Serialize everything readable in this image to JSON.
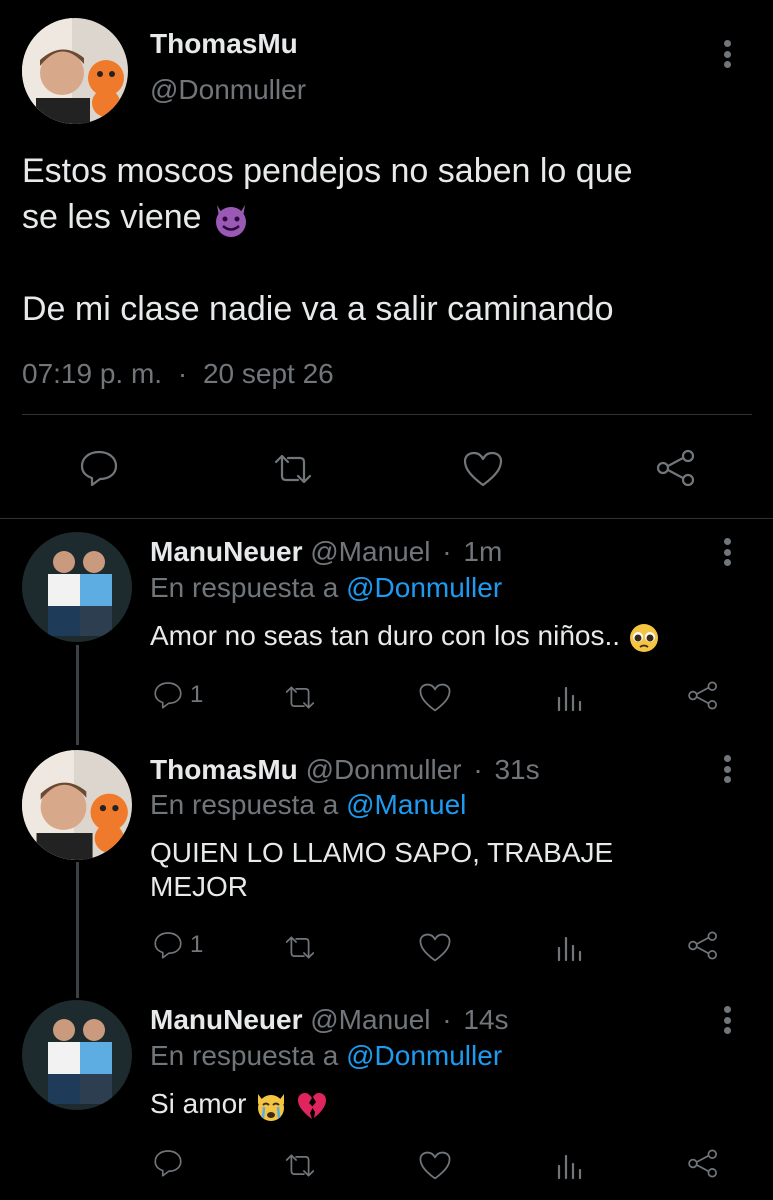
{
  "main_tweet": {
    "author_name": "ThomasMu",
    "author_handle": "@Donmuller",
    "text_line1": "Estos moscos pendejos no saben lo que",
    "text_line2": "se les viene",
    "emoji": "smiling-devil",
    "text_line3": "De mi clase nadie va a salir caminando",
    "time": "07:19 p. m.",
    "separator": "·",
    "date": "20 sept 26"
  },
  "replies": [
    {
      "author_name": "ManuNeuer",
      "author_handle": "@Manuel",
      "separator": "·",
      "age": "1m",
      "reply_prefix": "En respuesta a",
      "reply_to": "@Donmuller",
      "text_line1": "Amor no seas tan duro con los niños..",
      "text_line2": "",
      "emoji": "pleading-face",
      "reply_count": "1"
    },
    {
      "author_name": "ThomasMu",
      "author_handle": "@Donmuller",
      "separator": "·",
      "age": "31s",
      "reply_prefix": "En respuesta a",
      "reply_to": "@Manuel",
      "text_line1": "QUIEN LO LLAMO SAPO, TRABAJE",
      "text_line2": "MEJOR",
      "reply_count": "1"
    },
    {
      "author_name": "ManuNeuer",
      "author_handle": "@Manuel",
      "separator": "·",
      "age": "14s",
      "reply_prefix": "En respuesta a",
      "reply_to": "@Donmuller",
      "text_line1": "Si amor",
      "text_line2": "",
      "emoji": "crying-cat-broken-heart",
      "reply_count": ""
    }
  ],
  "colors": {
    "background": "#000000",
    "text": "#e7e9ea",
    "muted": "#71767b",
    "link": "#1d9bf0"
  }
}
